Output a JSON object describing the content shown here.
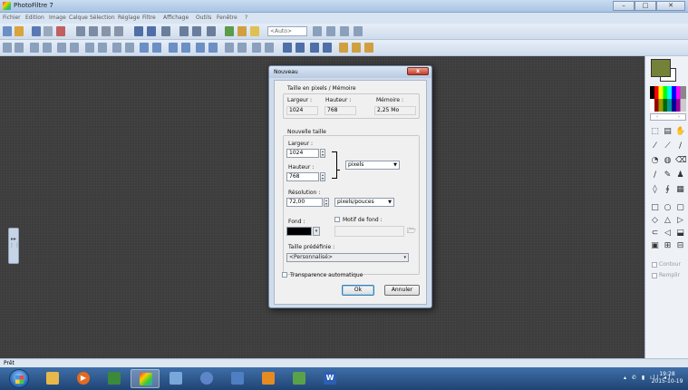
{
  "window": {
    "title": "PhotoFiltre 7"
  },
  "menu": [
    "Fichier",
    "Edition",
    "Image",
    "Calque",
    "Sélection",
    "Réglage",
    "Filtre",
    "Affichage",
    "Outils",
    "Fenêtre",
    "?"
  ],
  "toolbar": {
    "zoom_combo": "<Auto>"
  },
  "dialog": {
    "title": "Nouveau",
    "close": "x",
    "size_group": {
      "label": "Taille en pixels / Mémoire",
      "width_label": "Largeur :",
      "height_label": "Hauteur :",
      "memory_label": "Mémoire :",
      "width_value": "1024",
      "height_value": "768",
      "memory_value": "2,25 Mo"
    },
    "new_size": {
      "label": "Nouvelle taille",
      "width_label": "Largeur :",
      "width_value": "1024",
      "height_label": "Hauteur :",
      "height_value": "768",
      "unit": "pixels",
      "resolution_label": "Résolution :",
      "resolution_value": "72,00",
      "resolution_unit": "pixels/pouces",
      "background_label": "Fond :",
      "background_color": "#000000",
      "pattern_label": "Motif de fond :",
      "preset_label": "Taille prédéfinie :",
      "preset_value": "<Personnalisé>"
    },
    "transparency_label": "Transparence automatique",
    "ok_label": "Ok",
    "cancel_label": "Annuler"
  },
  "right_panel": {
    "contour_label": "Contour",
    "remplir_label": "Remplir"
  },
  "status": {
    "text": "Prêt"
  },
  "taskbar": {
    "time": "19:28",
    "date": "2015-10-19"
  },
  "colors": {
    "foreground": "#748139",
    "background": "#ffffff"
  }
}
